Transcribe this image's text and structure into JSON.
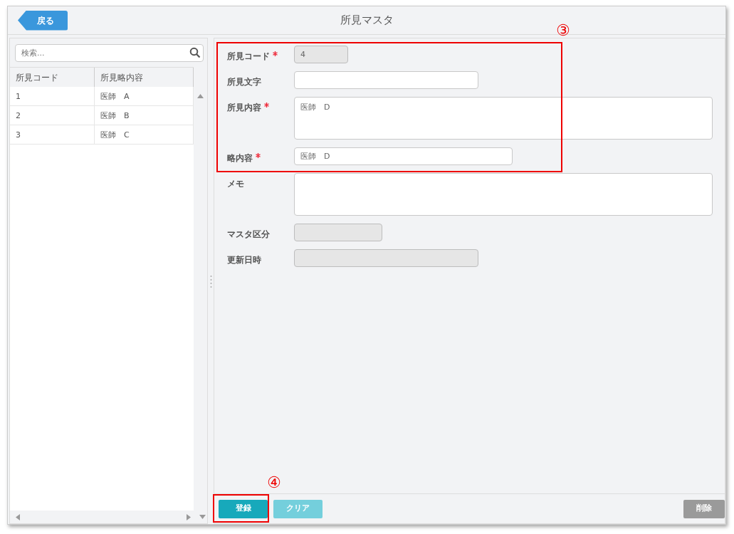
{
  "header": {
    "back_button": "戻る",
    "title": "所見マスタ"
  },
  "search": {
    "placeholder": "検索..."
  },
  "table": {
    "columns": [
      "所見コード",
      "所見略内容"
    ],
    "rows": [
      [
        "1",
        "医師　A"
      ],
      [
        "2",
        "医師　B"
      ],
      [
        "3",
        "医師　C"
      ]
    ]
  },
  "form": {
    "fields": [
      {
        "label": "所見コード",
        "required": true,
        "kind": "input",
        "disabled": true,
        "value": "4"
      },
      {
        "label": "所見文字",
        "required": false,
        "kind": "input",
        "disabled": false
      },
      {
        "label": "所見内容",
        "required": true,
        "kind": "textarea",
        "disabled": false,
        "value": "医師　D"
      },
      {
        "label": "略内容",
        "required": true,
        "kind": "input",
        "disabled": false,
        "value": "医師　D"
      },
      {
        "label": "メモ",
        "required": false,
        "kind": "textarea",
        "disabled": false
      },
      {
        "label": "マスタ区分",
        "required": false,
        "kind": "input",
        "disabled": true
      },
      {
        "label": "更新日時",
        "required": false,
        "kind": "input",
        "disabled": true
      }
    ]
  },
  "buttons": [
    {
      "label": "登録",
      "kind": "primary",
      "disabled": false
    },
    {
      "label": "クリア",
      "kind": "secondary",
      "disabled": true
    },
    {
      "label": "削除",
      "kind": "danger",
      "disabled": true
    }
  ],
  "annotations": [
    {
      "label": "③"
    },
    {
      "label": "④"
    }
  ]
}
